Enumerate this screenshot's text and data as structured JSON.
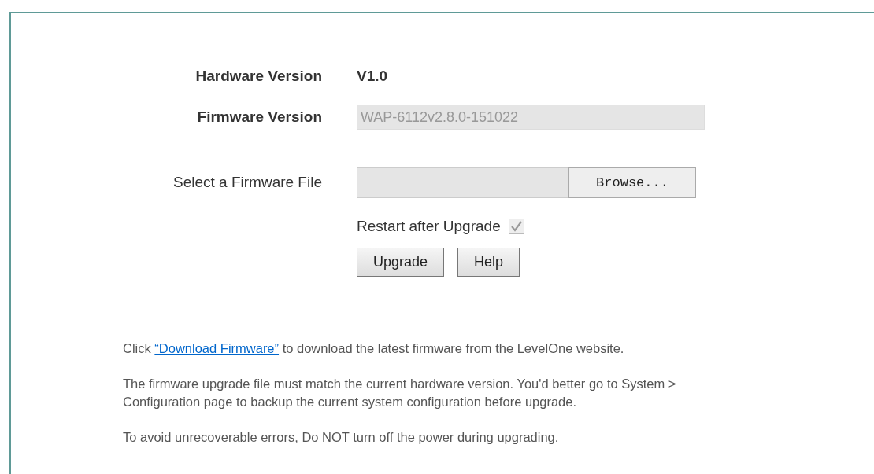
{
  "hardware_version": {
    "label": "Hardware Version",
    "value": "V1.0"
  },
  "firmware_version": {
    "label": "Firmware Version",
    "value": "WAP-6112v2.8.0-151022",
    "disabled": true
  },
  "firmware_file": {
    "label": "Select a Firmware File",
    "browse_button": "Browse..."
  },
  "restart_after_upgrade": {
    "label": "Restart after Upgrade",
    "checked": true,
    "disabled": true
  },
  "buttons": [
    "Upgrade",
    "Help"
  ],
  "notes": [
    {
      "kind": "link",
      "before": "Click ",
      "link": "“Download Firmware”",
      "after": " to download the latest firmware from the LevelOne website."
    },
    {
      "kind": "text",
      "text": "The firmware upgrade file must match the current hardware version. You'd better go to System > Configuration page to backup the current system configuration before upgrade."
    },
    {
      "kind": "text",
      "text": "To avoid unrecoverable errors, Do NOT turn off the power during upgrading."
    }
  ]
}
